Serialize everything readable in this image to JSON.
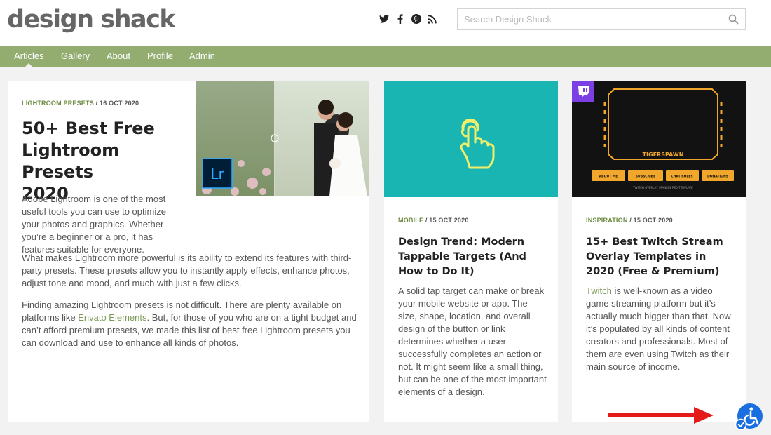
{
  "header": {
    "logo": "design shack",
    "social": [
      {
        "icon": "twitter-icon"
      },
      {
        "icon": "facebook-icon"
      },
      {
        "icon": "pinterest-icon"
      },
      {
        "icon": "rss-icon"
      }
    ],
    "search": {
      "placeholder": "Search Design Shack",
      "value": "",
      "icon": "search-icon"
    }
  },
  "nav": {
    "items": [
      {
        "label": "Articles",
        "active": true
      },
      {
        "label": "Gallery"
      },
      {
        "label": "About"
      },
      {
        "label": "Profile"
      },
      {
        "label": "Admin"
      }
    ]
  },
  "colors": {
    "nav_bg": "#93ad71",
    "category": "#6b8a3e",
    "card2_bg": "#18b5b3",
    "arrow": "#e31b1b",
    "accessibility": "#1a6fe0"
  },
  "articles": [
    {
      "category": "LIGHTROOM PRESETS",
      "date": "/ 16 OCT 2020",
      "title_lines": [
        "50+ Best Free",
        "Lightroom Presets",
        "2020"
      ],
      "image_badge": "Lr",
      "intro": "Adobe Lightroom is one of the most useful tools you can use to optimize your photos and graphics. Whether you’re a beginner or a pro, it has features suitable for everyone.",
      "p2": "What makes Lightroom more powerful is its ability to extend its features with third-party presets. These presets allow you to instantly apply effects, enhance photos, adjust tone and mood, and much with just a few clicks.",
      "p3_a": "Finding amazing Lightroom presets is not difficult. There are plenty available on platforms like ",
      "p3_link": "Envato Elements",
      "p3_b": ". But, for those of you who are on a tight budget and can’t afford premium presets, we made this list of best free Lightroom presets you can download and use to enhance all kinds of photos."
    },
    {
      "category": "MOBILE",
      "date": "/ 15 OCT 2020",
      "title": "Design Trend: Modern Tappable Targets (And How to Do It)",
      "image_icon": "tap-hand-icon",
      "excerpt": "A solid tap target can make or break your mobile website or app. The size, shape, location, and overall design of the button or link determines whether a user successfully completes an action or not. It might seem like a small thing, but can be one of the most important elements of a design."
    },
    {
      "category": "INSPIRATION",
      "date": "/ 15 OCT 2020",
      "title": "15+ Best Twitch Stream Overlay Templates in 2020 (Free & Premium)",
      "image_icon": "twitch-icon",
      "image_text": {
        "name": "TIGERSPAWN",
        "buttons": [
          "ABOUT ME",
          "SUBSCRIBE",
          "CHAT RULES",
          "DONATIONS"
        ],
        "caption": "TWITCH OVERLAY / PANELS PSD TEMPLATE"
      },
      "excerpt_link": "Twitch",
      "excerpt": " is well-known as a video game streaming platform but it’s actually much bigger than that. Now it’s populated by all kinds of content creators and professionals. Most of them are even using Twitch as their main source of income."
    }
  ],
  "overlay": {
    "arrow_icon": "red-arrow-icon",
    "accessibility_icon": "accessibility-icon"
  }
}
